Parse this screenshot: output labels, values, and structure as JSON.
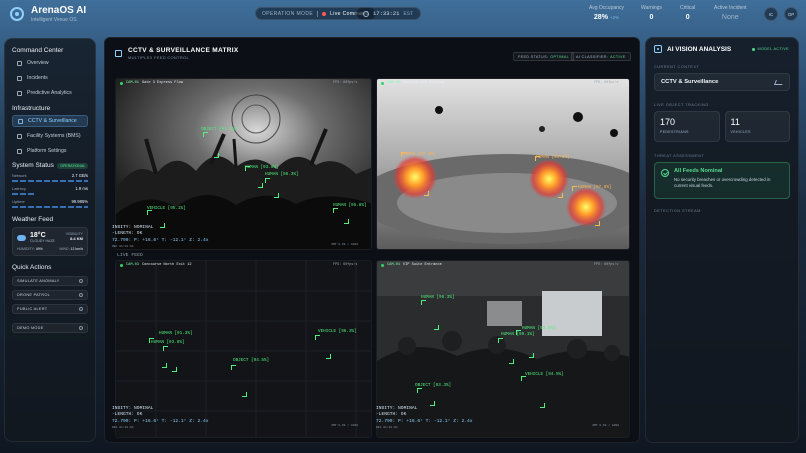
{
  "app": {
    "title": "ArenaOS AI",
    "subtitle": "Intelligent Venue OS"
  },
  "header": {
    "mode_label": "OPERATION MODE",
    "mode_value": "Live Command",
    "clock": "17:33:21",
    "timezone": "EST",
    "stats": [
      {
        "label": "Avg Occupancy",
        "value": "28%",
        "suffix": "+2%"
      },
      {
        "label": "Warnings",
        "value": "0"
      },
      {
        "label": "Critical",
        "value": "0"
      },
      {
        "label": "Active Incident",
        "value": "None"
      }
    ],
    "icon_buttons": [
      "IC",
      "OP"
    ]
  },
  "sidebar": {
    "command_center": "Command Center",
    "command_items": [
      "Overview",
      "Incidents",
      "Predictive Analytics"
    ],
    "infrastructure": "Infrastructure",
    "infra_items": [
      "CCTV & Surveillance",
      "Facility Systems (BMS)",
      "Platform Settings"
    ],
    "system_status": "System Status",
    "status_badge": "OPERATIONAL",
    "metrics": [
      {
        "label": "Network",
        "value": "2.7 GB/s"
      },
      {
        "label": "Latency",
        "value": "1.9 ms"
      },
      {
        "label": "Uptime",
        "value": "99.985%"
      }
    ],
    "weather_title": "Weather Feed",
    "weather": {
      "temp": "18°C",
      "condition": "CLOUDY HAZE",
      "extra_label": "VISIBILITY",
      "extra_value": "8.4 KM",
      "humidity_label": "HUMIDITY",
      "humidity": "49%",
      "wind_label": "WIND",
      "wind": "12 km/h"
    },
    "quick_actions_title": "Quick Actions",
    "quick_actions": [
      "SIMULATE ANOMALY",
      "DRONE PATROL",
      "PUBLIC ALERT",
      "DEMO MODE"
    ]
  },
  "main": {
    "title": "CCTV & SURVEILLANCE MATRIX",
    "subtitle": "MULTIPLEX FEED CONTROL",
    "feed_status_label": "FEED STATUS:",
    "feed_status_value": "OPTIMAL",
    "ai_class_label": "AI CLASSIFIER:",
    "ai_class_value": "ACTIVE",
    "partial_text": "LIVE FEED",
    "cameras": [
      {
        "id": "CAM-01",
        "name": "Gate 3 Express Flow",
        "fps": "FPS: 60fps/s",
        "status1": "INSITY: NOMINAL",
        "status2": "-LENGTH: OK",
        "coords": "72.799: P: +16.6° T: -12.1° Z: 2.4x",
        "rec": "REC 01:01:94",
        "res": "4MP 0.99 / 4096",
        "detections": [
          "OBJECT [91.3%]",
          "HUMAN [93.6%]",
          "HUMAN [96.3%]",
          "VEHICLE [95.1%]",
          "HUMAN [95.8%]"
        ]
      },
      {
        "id": "CAM-02",
        "name": "Section 112 Seating",
        "fps": "FPS: 60fps/s",
        "detections": [
          "HUMAN [97.3%]",
          "HUMAN [93.8%]",
          "HUMAN [97.8%]"
        ]
      },
      {
        "id": "CAM-03",
        "name": "Concourse North Exit 12",
        "fps": "FPS: 60fps/s",
        "status1": "INSITY: NOMINAL",
        "status2": "-LENGTH: OK",
        "coords": "72.799: P: +16.6° T: -12.1° Z: 2.4x",
        "rec": "REC 01:01:94",
        "res": "4MP 0.99 / 4096",
        "detections": [
          "HUMAN [91.3%]",
          "HUMAN [93.6%]",
          "VEHICLE [96.3%]",
          "OBJECT [94.5%]"
        ]
      },
      {
        "id": "CAM-04",
        "name": "VIP Suite Entrance",
        "fps": "FPS: 60fps/s",
        "status1": "INSITY: NOMINAL",
        "status2": "-LENGTH: OK",
        "coords": "72.799: P: +16.6° T: -12.1° Z: 2.4x",
        "rec": "REC 01:01:94",
        "res": "4MP 0.99 / 4096",
        "detections": [
          "HUMAN [96.3%]",
          "HUMAN [93.6%]",
          "HUMAN [99.1%]",
          "VEHICLE [94.5%]",
          "OBJECT [93.3%]"
        ]
      }
    ]
  },
  "right_panel": {
    "title": "AI VISION ANALYSIS",
    "badge": "MODEL ACTIVE",
    "context_label": "CURRENT CONTEXT",
    "context_value": "CCTV & Surveillance",
    "tracking_label": "LIVE OBJECT TRACKING",
    "pedestrians": "170",
    "pedestrians_label": "PEDESTRIANS",
    "vehicles": "11",
    "vehicles_label": "VEHICLES",
    "threat_label": "THREAT ASSESSMENT",
    "threat_title": "All Feeds Nominal",
    "threat_text": "No security breaches or overcrowding detected in current visual feeds.",
    "stream_label": "DETECTION STREAM"
  },
  "colors": {
    "accent": "#8fd0ff",
    "ok": "#55d98d",
    "detect": "#4ff07d"
  }
}
